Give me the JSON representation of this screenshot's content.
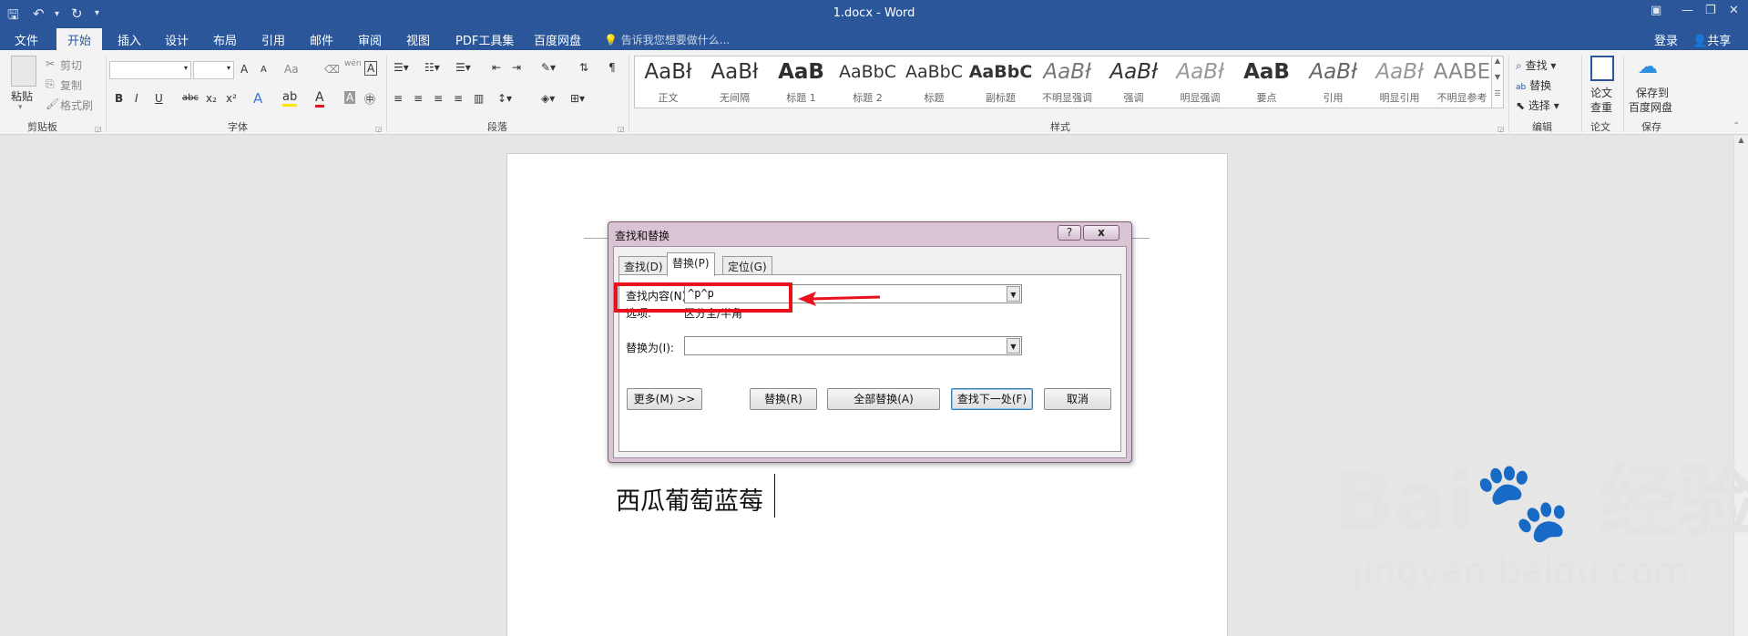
{
  "window": {
    "title": "1.docx - Word",
    "quick_access": {
      "save_icon": "save-icon",
      "undo_icon": "undo-icon",
      "redo_icon": "redo-icon",
      "customize_icon": "customize-qat-icon"
    },
    "controls": [
      "ribbon-display-icon",
      "minimize-icon",
      "restore-icon",
      "close-icon"
    ]
  },
  "ribbon_tabs": {
    "file": "文件",
    "home": "开始",
    "insert": "插入",
    "design": "设计",
    "layout": "布局",
    "references": "引用",
    "mailings": "邮件",
    "review": "审阅",
    "view": "视图",
    "pdf": "PDF工具集",
    "baidu": "百度网盘",
    "tell_me": "告诉我您想要做什么...",
    "login": "登录",
    "share": "共享"
  },
  "clipboard": {
    "paste": "粘贴",
    "cut": "剪切",
    "copy": "复制",
    "format_painter": "格式刷",
    "group_label": "剪贴板"
  },
  "font": {
    "font_name": "",
    "font_size": "",
    "group_label": "字体",
    "bold": "B",
    "italic": "I",
    "underline": "U",
    "strike": "abc",
    "subscript": "x₂",
    "superscript": "x²",
    "grow": "A",
    "shrink": "A",
    "case": "Aa",
    "phonetic": "wén"
  },
  "paragraph": {
    "group_label": "段落"
  },
  "styles": {
    "group_label": "样式",
    "items": [
      {
        "preview": "AaBł",
        "name": "正文"
      },
      {
        "preview": "AaBł",
        "name": "无间隔"
      },
      {
        "preview": "AaB",
        "name": "标题 1"
      },
      {
        "preview": "AaBbC",
        "name": "标题 2"
      },
      {
        "preview": "AaBbC",
        "name": "标题"
      },
      {
        "preview": "AaBbC",
        "name": "副标题"
      },
      {
        "preview": "AaBł",
        "name": "不明显强调"
      },
      {
        "preview": "AaBł",
        "name": "强调"
      },
      {
        "preview": "AaBł",
        "name": "明显强调"
      },
      {
        "preview": "AaB",
        "name": "要点"
      },
      {
        "preview": "AaBł",
        "name": "引用"
      },
      {
        "preview": "AaBł",
        "name": "明显引用"
      },
      {
        "preview": "AABE",
        "name": "不明显参考"
      }
    ]
  },
  "editing": {
    "find": "查找",
    "replace": "替换",
    "select": "选择",
    "group_label": "编辑"
  },
  "paper": {
    "check_line1": "论文",
    "check_line2": "查重",
    "group_label": "论文"
  },
  "save_baidu": {
    "line1": "保存到",
    "line2": "百度网盘",
    "group_label": "保存"
  },
  "dialog": {
    "title": "查找和替换",
    "help": "?",
    "close": "x",
    "tabs": {
      "find": "查找(D)",
      "replace": "替换(P)",
      "goto": "定位(G)"
    },
    "find_label": "查找内容(N):",
    "find_value": "^p^p",
    "options_label": "选项:",
    "options_value": "区分全/半角",
    "replace_label": "替换为(I):",
    "replace_value": "",
    "buttons": {
      "more": "更多(M) >>",
      "replace": "替换(R)",
      "replace_all": "全部替换(A)",
      "find_next": "查找下一处(F)",
      "cancel": "取消"
    }
  },
  "document": {
    "text": "西瓜葡萄蓝莓"
  },
  "watermark": {
    "line1": "Bai🐾 经验",
    "line2": "jingyan.baidu.com"
  },
  "colors": {
    "accent": "#2b579a",
    "annotation": "#e8121e",
    "dialog_frame": "#d9c4d3"
  }
}
